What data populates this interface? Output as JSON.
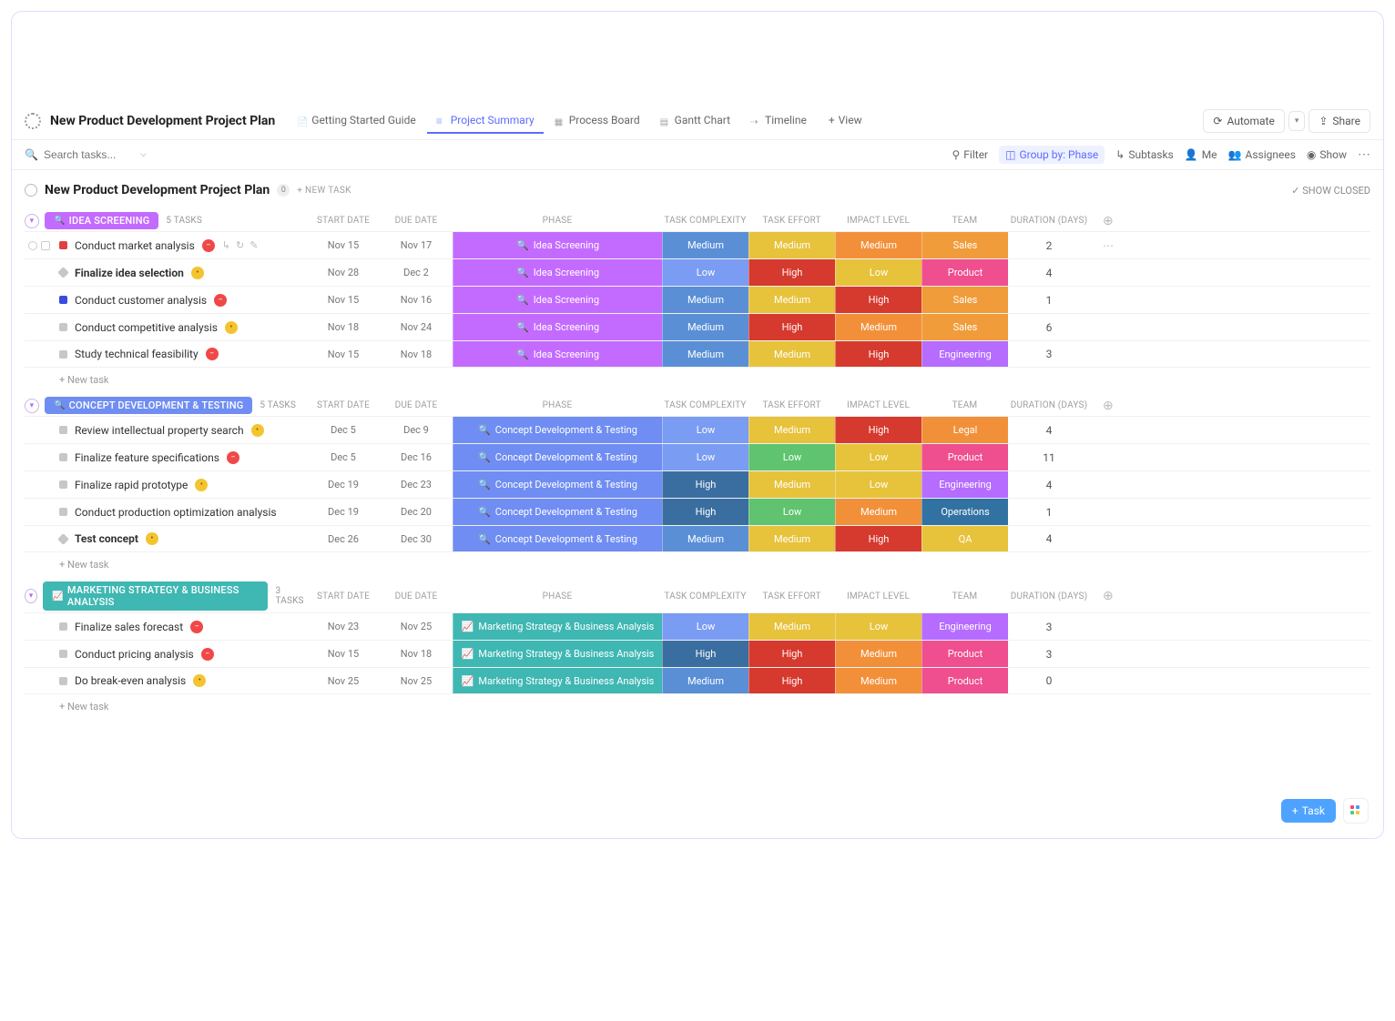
{
  "page": {
    "title": "New Product Development Project Plan"
  },
  "tabs": [
    {
      "label": "Getting Started Guide",
      "iconClass": "icon-doc"
    },
    {
      "label": "Project Summary",
      "iconClass": "icon-list",
      "active": true
    },
    {
      "label": "Process Board",
      "iconClass": "icon-board"
    },
    {
      "label": "Gantt Chart",
      "iconClass": "icon-gantt"
    },
    {
      "label": "Timeline",
      "iconClass": "icon-timeline"
    }
  ],
  "addView": "View",
  "header_buttons": {
    "automate": "Automate",
    "share": "Share"
  },
  "search": {
    "placeholder": "Search tasks..."
  },
  "toolbar": {
    "filter": "Filter",
    "groupby": "Group by: Phase",
    "subtasks": "Subtasks",
    "me": "Me",
    "assignees": "Assignees",
    "show": "Show"
  },
  "section": {
    "title": "New Product Development Project Plan",
    "count": "0",
    "newtask": "+ NEW TASK",
    "show_closed": "SHOW CLOSED"
  },
  "columns": {
    "start": "START DATE",
    "due": "DUE DATE",
    "phase": "PHASE",
    "complexity": "TASK COMPLEXITY",
    "effort": "TASK EFFORT",
    "impact": "IMPACT LEVEL",
    "team": "TEAM",
    "duration": "DURATION (DAYS)"
  },
  "colors": {
    "phase_idea": "#c46bff",
    "phase_concept": "#6f8df2",
    "phase_marketing": "#3fb7b3",
    "complexity_medium": "#5a8fd6",
    "complexity_low": "#7a9cf2",
    "complexity_high": "#3a6ea0",
    "effort_medium": "#e7c23b",
    "effort_high": "#d6392e",
    "effort_low": "#5fc36f",
    "impact_medium": "#f2903a",
    "impact_high": "#d6392e",
    "impact_low": "#e7c23b",
    "team_sales": "#f09c3a",
    "team_product": "#ef4f8e",
    "team_engineering": "#b56cff",
    "team_legal": "#f2903a",
    "team_operations": "#3272a3",
    "team_qa": "#e7c23b"
  },
  "groups": [
    {
      "name": "Idea Screening",
      "pillColor": "#c46bff",
      "pillIcon": "🔍",
      "taskCount": "5 TASKS",
      "rows": [
        {
          "status": "#e0423f",
          "name": "Conduct market analysis",
          "dot": "red",
          "start": "Nov 15",
          "due": "Nov 17",
          "phase": "Idea Screening",
          "phaseColorKey": "phase_idea",
          "complexity": "Medium",
          "complexityKey": "complexity_medium",
          "effort": "Medium",
          "effortKey": "effort_medium",
          "impact": "Medium",
          "impactKey": "impact_medium",
          "team": "Sales",
          "teamKey": "team_sales",
          "duration": "2",
          "showRowActions": true,
          "showMore": true,
          "showLeadControls": true
        },
        {
          "status": "#c7c7c7",
          "bold": true,
          "diamond": true,
          "name": "Finalize idea selection",
          "dot": "yellow",
          "start": "Nov 28",
          "due": "Dec 2",
          "phase": "Idea Screening",
          "phaseColorKey": "phase_idea",
          "complexity": "Low",
          "complexityKey": "complexity_low",
          "effort": "High",
          "effortKey": "effort_high",
          "impact": "Low",
          "impactKey": "impact_low",
          "team": "Product",
          "teamKey": "team_product",
          "duration": "4"
        },
        {
          "status": "#3a4bdf",
          "name": "Conduct customer analysis",
          "dot": "red",
          "start": "Nov 15",
          "due": "Nov 16",
          "phase": "Idea Screening",
          "phaseColorKey": "phase_idea",
          "complexity": "Medium",
          "complexityKey": "complexity_medium",
          "effort": "Medium",
          "effortKey": "effort_medium",
          "impact": "High",
          "impactKey": "impact_high",
          "team": "Sales",
          "teamKey": "team_sales",
          "duration": "1"
        },
        {
          "status": "#c7c7c7",
          "name": "Conduct competitive analysis",
          "dot": "yellow",
          "start": "Nov 18",
          "due": "Nov 24",
          "phase": "Idea Screening",
          "phaseColorKey": "phase_idea",
          "complexity": "Medium",
          "complexityKey": "complexity_medium",
          "effort": "High",
          "effortKey": "effort_high",
          "impact": "Medium",
          "impactKey": "impact_medium",
          "team": "Sales",
          "teamKey": "team_sales",
          "duration": "6"
        },
        {
          "status": "#c7c7c7",
          "name": "Study technical feasibility",
          "dot": "red",
          "start": "Nov 15",
          "due": "Nov 18",
          "phase": "Idea Screening",
          "phaseColorKey": "phase_idea",
          "complexity": "Medium",
          "complexityKey": "complexity_medium",
          "effort": "Medium",
          "effortKey": "effort_medium",
          "impact": "High",
          "impactKey": "impact_high",
          "team": "Engineering",
          "teamKey": "team_engineering",
          "duration": "3"
        }
      ],
      "newtask": "+ New task"
    },
    {
      "name": "Concept Development & Testing",
      "pillColor": "#6f8df2",
      "pillIcon": "🔍",
      "taskCount": "5 TASKS",
      "rows": [
        {
          "status": "#c7c7c7",
          "name": "Review intellectual property search",
          "dot": "yellow",
          "start": "Dec 5",
          "due": "Dec 9",
          "phase": "Concept Development & Testing",
          "phaseColorKey": "phase_concept",
          "complexity": "Low",
          "complexityKey": "complexity_low",
          "effort": "Medium",
          "effortKey": "effort_medium",
          "impact": "High",
          "impactKey": "impact_high",
          "team": "Legal",
          "teamKey": "team_legal",
          "duration": "4"
        },
        {
          "status": "#c7c7c7",
          "name": "Finalize feature specifications",
          "dot": "red",
          "start": "Dec 5",
          "due": "Dec 16",
          "phase": "Concept Development & Testing",
          "phaseColorKey": "phase_concept",
          "complexity": "Low",
          "complexityKey": "complexity_low",
          "effort": "Low",
          "effortKey": "effort_low",
          "impact": "Low",
          "impactKey": "impact_low",
          "team": "Product",
          "teamKey": "team_product",
          "duration": "11"
        },
        {
          "status": "#c7c7c7",
          "name": "Finalize rapid prototype",
          "dot": "yellow",
          "start": "Dec 19",
          "due": "Dec 23",
          "phase": "Concept Development & Testing",
          "phaseColorKey": "phase_concept",
          "complexity": "High",
          "complexityKey": "complexity_high",
          "effort": "Medium",
          "effortKey": "effort_medium",
          "impact": "Low",
          "impactKey": "impact_low",
          "team": "Engineering",
          "teamKey": "team_engineering",
          "duration": "4"
        },
        {
          "status": "#c7c7c7",
          "name": "Conduct production optimization analysis",
          "start": "Dec 19",
          "due": "Dec 20",
          "phase": "Concept Development & Testing",
          "phaseColorKey": "phase_concept",
          "complexity": "High",
          "complexityKey": "complexity_high",
          "effort": "Low",
          "effortKey": "effort_low",
          "impact": "Medium",
          "impactKey": "impact_medium",
          "team": "Operations",
          "teamKey": "team_operations",
          "duration": "1"
        },
        {
          "status": "#c7c7c7",
          "bold": true,
          "diamond": true,
          "name": "Test concept",
          "dot": "yellow",
          "start": "Dec 26",
          "due": "Dec 30",
          "phase": "Concept Development & Testing",
          "phaseColorKey": "phase_concept",
          "complexity": "Medium",
          "complexityKey": "complexity_medium",
          "effort": "Medium",
          "effortKey": "effort_medium",
          "impact": "High",
          "impactKey": "impact_high",
          "team": "QA",
          "teamKey": "team_qa",
          "duration": "4"
        }
      ],
      "newtask": "+ New task"
    },
    {
      "name": "Marketing Strategy & Business Analysis",
      "pillColor": "#3fb7b3",
      "pillIcon": "📈",
      "taskCount": "3 TASKS",
      "rows": [
        {
          "status": "#c7c7c7",
          "name": "Finalize sales forecast",
          "dot": "red",
          "start": "Nov 23",
          "due": "Nov 25",
          "phase": "Marketing Strategy & Business Analysis",
          "phaseColorKey": "phase_marketing",
          "complexity": "Low",
          "complexityKey": "complexity_low",
          "effort": "Medium",
          "effortKey": "effort_medium",
          "impact": "Low",
          "impactKey": "impact_low",
          "team": "Engineering",
          "teamKey": "team_engineering",
          "duration": "3"
        },
        {
          "status": "#c7c7c7",
          "name": "Conduct pricing analysis",
          "dot": "red",
          "start": "Nov 15",
          "due": "Nov 18",
          "phase": "Marketing Strategy & Business Analysis",
          "phaseColorKey": "phase_marketing",
          "complexity": "High",
          "complexityKey": "complexity_high",
          "effort": "High",
          "effortKey": "effort_high",
          "impact": "Medium",
          "impactKey": "impact_medium",
          "team": "Product",
          "teamKey": "team_product",
          "duration": "3"
        },
        {
          "status": "#c7c7c7",
          "name": "Do break-even analysis",
          "dot": "yellow",
          "start": "Nov 25",
          "due": "Nov 25",
          "phase": "Marketing Strategy & Business Analysis",
          "phaseColorKey": "phase_marketing",
          "complexity": "Medium",
          "complexityKey": "complexity_medium",
          "effort": "High",
          "effortKey": "effort_high",
          "impact": "Medium",
          "impactKey": "impact_medium",
          "team": "Product",
          "teamKey": "team_product",
          "duration": "0"
        }
      ],
      "newtask": "+ New task"
    }
  ],
  "fab": {
    "task": "Task"
  }
}
